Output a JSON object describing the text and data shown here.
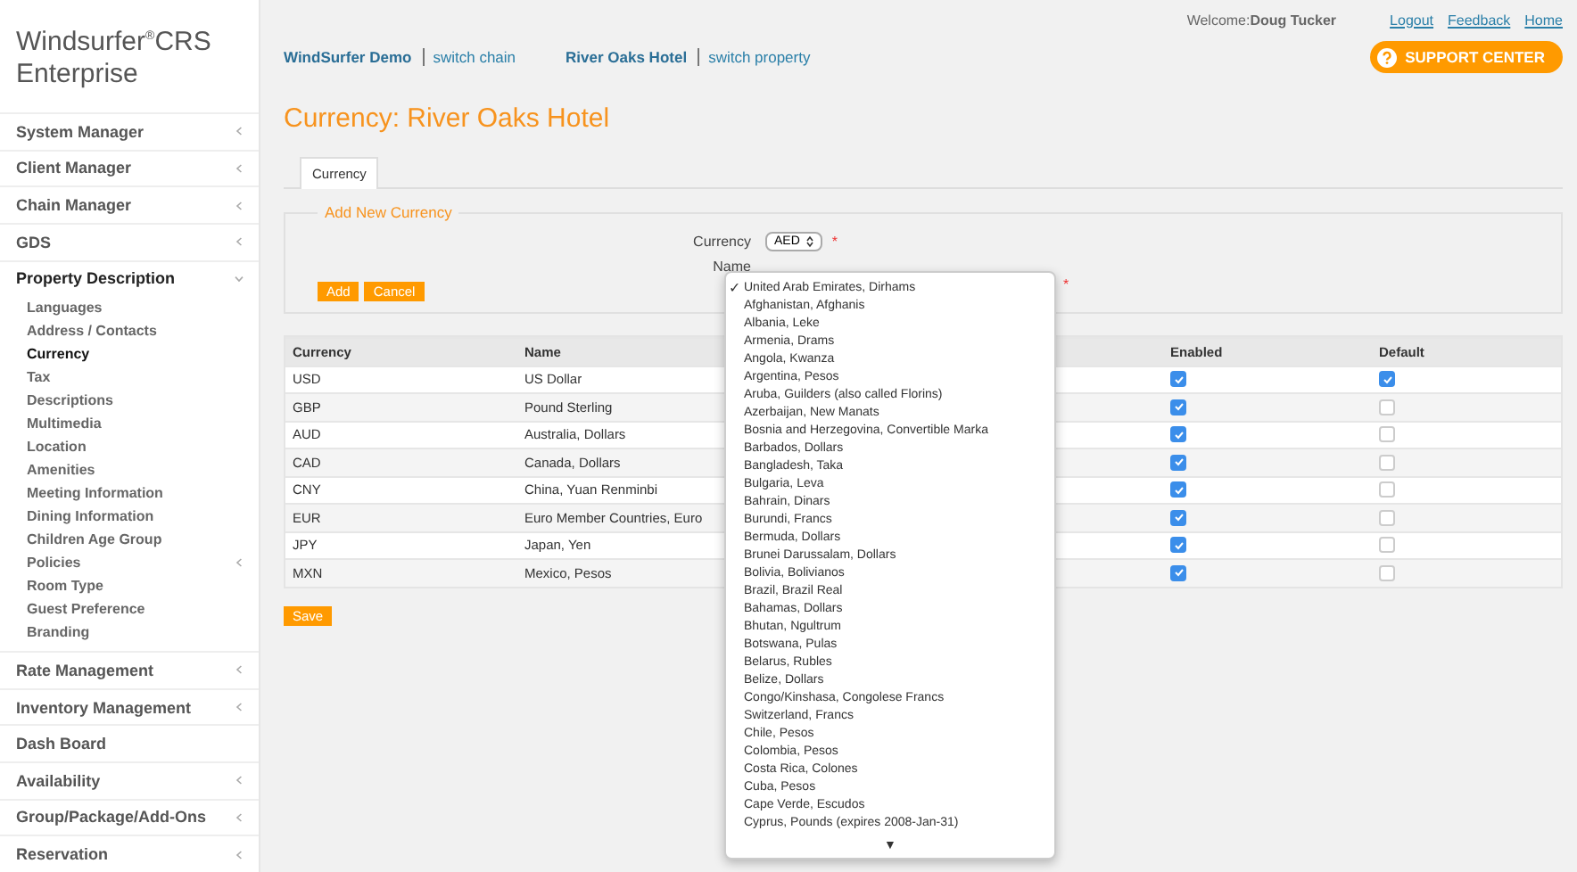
{
  "brand": "Windsurfer$^{®}$CRS Enterprise",
  "sidebar": {
    "items": [
      {
        "label": "System Manager",
        "has_arrow": true,
        "expanded": false
      },
      {
        "label": "Client Manager",
        "has_arrow": true,
        "expanded": false
      },
      {
        "label": "Chain Manager",
        "has_arrow": true,
        "expanded": false
      },
      {
        "label": "GDS",
        "has_arrow": true,
        "expanded": false
      },
      {
        "label": "Property Description",
        "has_arrow": true,
        "expanded": true,
        "children": [
          {
            "label": "Languages",
            "selected": false,
            "has_arrow": false
          },
          {
            "label": "Address / Contacts",
            "selected": false,
            "has_arrow": false
          },
          {
            "label": "Currency",
            "selected": true,
            "has_arrow": false
          },
          {
            "label": "Tax",
            "selected": false,
            "has_arrow": false
          },
          {
            "label": "Descriptions",
            "selected": false,
            "has_arrow": false
          },
          {
            "label": "Multimedia",
            "selected": false,
            "has_arrow": false
          },
          {
            "label": "Location",
            "selected": false,
            "has_arrow": false
          },
          {
            "label": "Amenities",
            "selected": false,
            "has_arrow": false
          },
          {
            "label": "Meeting Information",
            "selected": false,
            "has_arrow": false
          },
          {
            "label": "Dining Information",
            "selected": false,
            "has_arrow": false
          },
          {
            "label": "Children Age Group",
            "selected": false,
            "has_arrow": false
          },
          {
            "label": "Policies",
            "selected": false,
            "has_arrow": true
          },
          {
            "label": "Room Type",
            "selected": false,
            "has_arrow": false
          },
          {
            "label": "Guest Preference",
            "selected": false,
            "has_arrow": false
          },
          {
            "label": "Branding",
            "selected": false,
            "has_arrow": false
          }
        ]
      },
      {
        "label": "Rate Management",
        "has_arrow": true,
        "expanded": false
      },
      {
        "label": "Inventory Management",
        "has_arrow": true,
        "expanded": false
      },
      {
        "label": "Dash Board",
        "has_arrow": false,
        "expanded": false
      },
      {
        "label": "Availability",
        "has_arrow": true,
        "expanded": false
      },
      {
        "label": "Group/Package/Add-Ons",
        "has_arrow": true,
        "expanded": false
      },
      {
        "label": "Reservation",
        "has_arrow": true,
        "expanded": false
      }
    ]
  },
  "top_bar": {
    "welcome": "Welcome:",
    "user": "Doug Tucker",
    "links": [
      "Logout",
      "Feedback",
      "Home"
    ],
    "support": "SUPPORT CENTER"
  },
  "context": {
    "chain": "WindSurfer Demo",
    "switch_chain": "switch chain",
    "property": "River Oaks Hotel",
    "switch_property": "switch property"
  },
  "title": "Currency: River Oaks Hotel",
  "tabs": [
    {
      "label": "Currency",
      "selected": true
    }
  ],
  "form": {
    "legend": "Add New Currency",
    "currency_label": "Currency",
    "currency_value": "AED",
    "name_label": "Name",
    "required": "*",
    "buttons": [
      "Add",
      "Cancel"
    ]
  },
  "table": {
    "columns": [
      "Currency",
      "Name",
      "Enabled",
      "Default"
    ],
    "rows": [
      {
        "code": "USD",
        "name": "US Dollar",
        "enabled": true,
        "default": true
      },
      {
        "code": "GBP",
        "name": "Pound Sterling",
        "enabled": true,
        "default": false
      },
      {
        "code": "AUD",
        "name": "Australia, Dollars",
        "enabled": true,
        "default": false
      },
      {
        "code": "CAD",
        "name": "Canada, Dollars",
        "enabled": true,
        "default": false
      },
      {
        "code": "CNY",
        "name": "China, Yuan Renminbi",
        "enabled": true,
        "default": false
      },
      {
        "code": "EUR",
        "name": "Euro Member Countries, Euro",
        "enabled": true,
        "default": false
      },
      {
        "code": "JPY",
        "name": "Japan, Yen",
        "enabled": true,
        "default": false
      },
      {
        "code": "MXN",
        "name": "Mexico, Pesos",
        "enabled": true,
        "default": false
      }
    ]
  },
  "save": "Save",
  "dropdown": {
    "check": "✓",
    "more": "▼",
    "options": [
      {
        "label": "United Arab Emirates, Dirhams",
        "selected": true
      },
      {
        "label": "Afghanistan, Afghanis",
        "selected": false
      },
      {
        "label": "Albania, Leke",
        "selected": false
      },
      {
        "label": "Armenia, Drams",
        "selected": false
      },
      {
        "label": "Angola, Kwanza",
        "selected": false
      },
      {
        "label": "Argentina, Pesos",
        "selected": false
      },
      {
        "label": "Aruba, Guilders (also called Florins)",
        "selected": false
      },
      {
        "label": "Azerbaijan, New Manats",
        "selected": false
      },
      {
        "label": "Bosnia and Herzegovina, Convertible Marka",
        "selected": false
      },
      {
        "label": "Barbados, Dollars",
        "selected": false
      },
      {
        "label": "Bangladesh, Taka",
        "selected": false
      },
      {
        "label": "Bulgaria, Leva",
        "selected": false
      },
      {
        "label": "Bahrain, Dinars",
        "selected": false
      },
      {
        "label": "Burundi, Francs",
        "selected": false
      },
      {
        "label": "Bermuda, Dollars",
        "selected": false
      },
      {
        "label": "Brunei Darussalam, Dollars",
        "selected": false
      },
      {
        "label": "Bolivia, Bolivianos",
        "selected": false
      },
      {
        "label": "Brazil, Brazil Real",
        "selected": false
      },
      {
        "label": "Bahamas, Dollars",
        "selected": false
      },
      {
        "label": "Bhutan, Ngultrum",
        "selected": false
      },
      {
        "label": "Botswana, Pulas",
        "selected": false
      },
      {
        "label": "Belarus, Rubles",
        "selected": false
      },
      {
        "label": "Belize, Dollars",
        "selected": false
      },
      {
        "label": "Congo/Kinshasa, Congolese Francs",
        "selected": false
      },
      {
        "label": "Switzerland, Francs",
        "selected": false
      },
      {
        "label": "Chile, Pesos",
        "selected": false
      },
      {
        "label": "Colombia, Pesos",
        "selected": false
      },
      {
        "label": "Costa Rica, Colones",
        "selected": false
      },
      {
        "label": "Cuba, Pesos",
        "selected": false
      },
      {
        "label": "Cape Verde, Escudos",
        "selected": false
      },
      {
        "label": "Cyprus, Pounds (expires 2008-Jan-31)",
        "selected": false
      }
    ]
  }
}
